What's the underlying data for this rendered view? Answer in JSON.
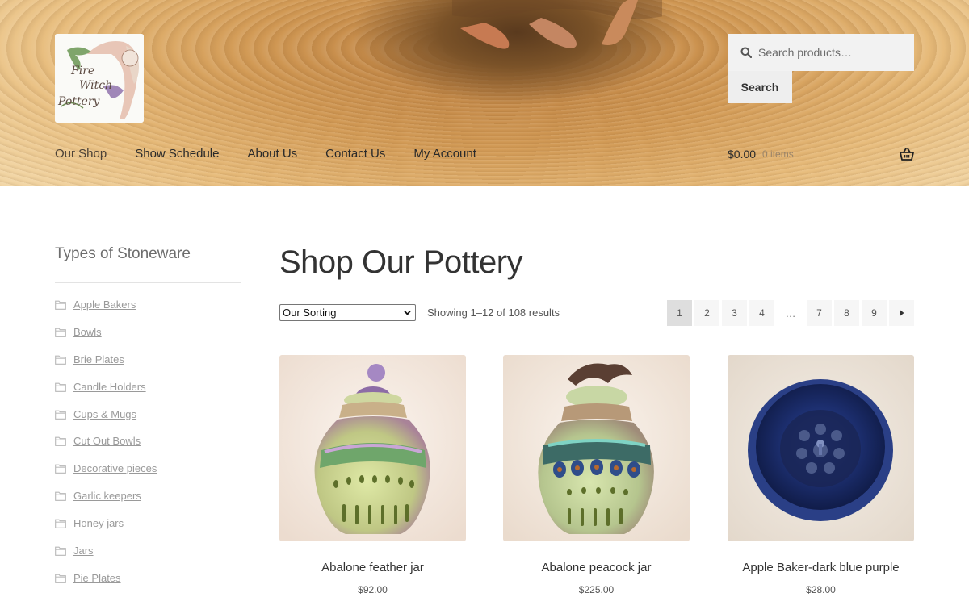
{
  "header": {
    "logo_alt": "Fire Witch Pottery",
    "logo_text": [
      "Fire",
      "Witch",
      "Pottery"
    ],
    "search": {
      "placeholder": "Search products…",
      "button_label": "Search"
    },
    "nav": [
      {
        "label": "Our Shop",
        "current": true
      },
      {
        "label": "Show Schedule"
      },
      {
        "label": "About Us"
      },
      {
        "label": "Contact Us"
      },
      {
        "label": "My Account"
      }
    ],
    "cart": {
      "amount": "$0.00",
      "count": "0 items"
    }
  },
  "sidebar": {
    "title": "Types of Stoneware",
    "categories": [
      "Apple Bakers",
      "Bowls",
      "Brie Plates",
      "Candle Holders",
      "Cups & Mugs",
      "Cut Out Bowls",
      "Decorative pieces",
      "Garlic keepers",
      "Honey jars",
      "Jars",
      "Pie Plates"
    ]
  },
  "main": {
    "title": "Shop Our Pottery",
    "sorting": {
      "selected": "Our Sorting"
    },
    "result_count": "Showing 1–12 of 108 results",
    "pagination": {
      "pages_before": [
        "1",
        "2",
        "3",
        "4"
      ],
      "dots": "…",
      "pages_after": [
        "7",
        "8",
        "9"
      ],
      "current": "1",
      "next_icon": "arrow-right-icon"
    },
    "products": [
      {
        "name": "Abalone feather jar",
        "price": "$92.00"
      },
      {
        "name": "Abalone peacock jar",
        "price": "$225.00"
      },
      {
        "name": "Apple Baker-dark blue purple",
        "price": "$28.00"
      }
    ]
  },
  "colors": {
    "accent": "#333333",
    "link": "#9a9a9a",
    "header_tone": "#d29a55"
  }
}
